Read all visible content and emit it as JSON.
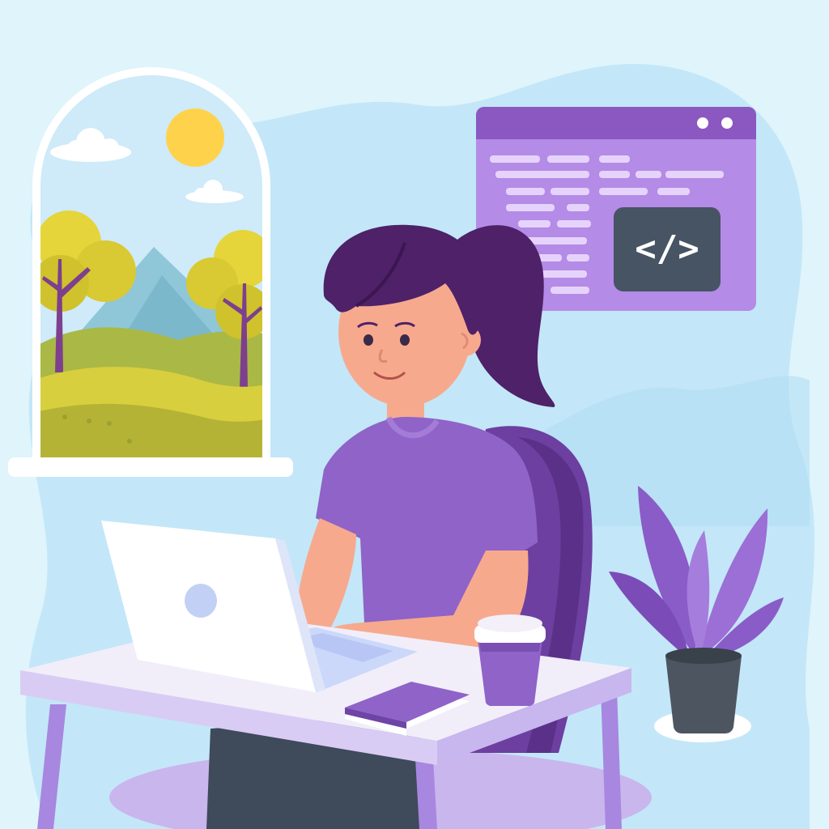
{
  "code_window": {
    "tag_label": "</>"
  },
  "colors": {
    "background": "#dff4fb",
    "blob": "#c3e7f8",
    "purple_dark": "#4e2168",
    "purple_mid": "#8f63c8",
    "purple_light": "#b48be6",
    "skin": "#f7a98e",
    "desk": "#f1eefa",
    "screen_dark": "#475463",
    "plant_pot": "#4c5560",
    "sun": "#ffd24c"
  },
  "icons": [
    "code-icon",
    "sun-icon",
    "cloud-icon",
    "laptop-logo-icon",
    "window-dot-icon"
  ]
}
